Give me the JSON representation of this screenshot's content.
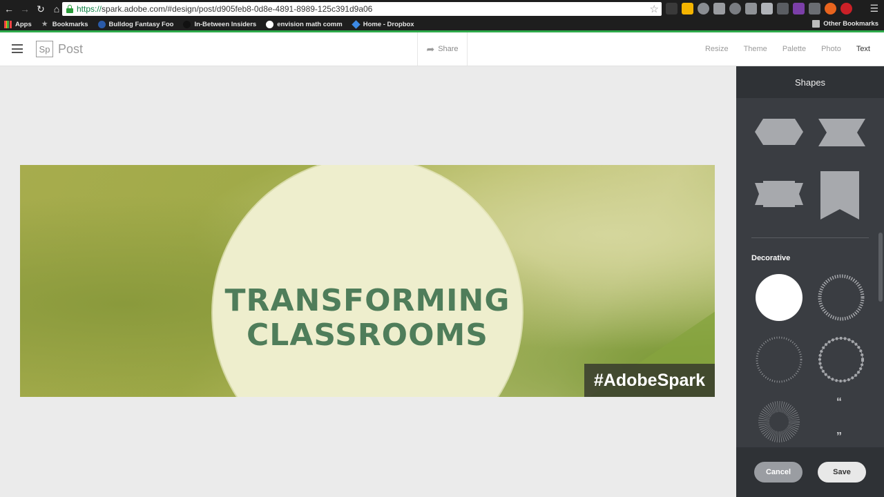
{
  "browser": {
    "url_scheme": "https://",
    "url_rest": "spark.adobe.com/#design/post/d905feb8-0d8e-4891-8989-125c391d9a06",
    "bookmarks": [
      "Apps",
      "Bookmarks",
      "Bulldog Fantasy Foo",
      "In-Between Insiders",
      "envision math comm",
      "Home - Dropbox"
    ],
    "other_bookmarks": "Other Bookmarks"
  },
  "header": {
    "logo": "Sp",
    "title": "Post",
    "share_label": "Share",
    "tabs": [
      "Resize",
      "Theme",
      "Palette",
      "Photo",
      "Text"
    ],
    "active_tab": "Text"
  },
  "design": {
    "line1": "TRANSFORMING",
    "line2": "CLASSROOMS",
    "hashtag": "#AdobeSpark",
    "colors": {
      "text": "#4f7d5a",
      "circle": "#eeeecd",
      "background": "#a7ac4d"
    }
  },
  "panel": {
    "title": "Shapes",
    "section": "Decorative",
    "open_quote": "“",
    "close_quote": "”",
    "cancel_label": "Cancel",
    "save_label": "Save"
  }
}
